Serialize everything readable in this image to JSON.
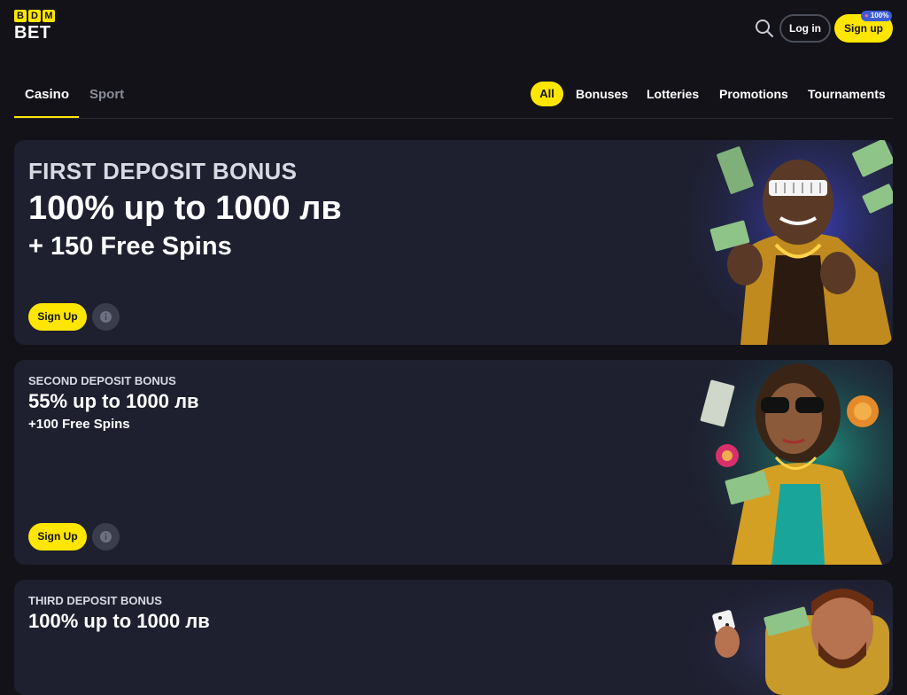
{
  "header": {
    "logo_top_letters": [
      "B",
      "D",
      "M"
    ],
    "logo_bottom": "BET",
    "search_icon": "search-icon",
    "login_label": "Log in",
    "signup_label": "Sign up",
    "signup_badge": "100%"
  },
  "nav": {
    "tabs": [
      {
        "label": "Casino",
        "active": true
      },
      {
        "label": "Sport",
        "active": false
      }
    ],
    "filters": [
      {
        "label": "All",
        "active": true
      },
      {
        "label": "Bonuses"
      },
      {
        "label": "Lotteries"
      },
      {
        "label": "Promotions"
      },
      {
        "label": "Tournaments"
      }
    ]
  },
  "cards": [
    {
      "label": "FIRST DEPOSIT BONUS",
      "amount": "100% up to 1000 лв",
      "spins": "+ 150 Free Spins",
      "signup_label": "Sign Up",
      "info_icon": "info-icon"
    },
    {
      "label": "SECOND DEPOSIT BONUS",
      "amount": "55% up to 1000 лв",
      "spins": "+100 Free Spins",
      "signup_label": "Sign Up",
      "info_icon": "info-icon"
    },
    {
      "label": "THIRD DEPOSIT BONUS",
      "amount": "100% up to 1000 лв"
    }
  ],
  "colors": {
    "background": "#121218",
    "card": "#1e2030",
    "accent": "#ffe600",
    "muted_text": "#8a8d98",
    "badge": "#3b5bdb"
  }
}
